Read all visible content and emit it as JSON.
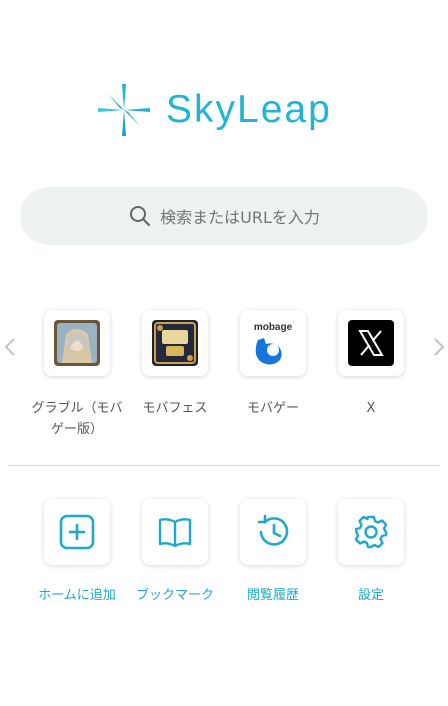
{
  "brand": {
    "name": "SkyLeap",
    "accent": "#22b4d6"
  },
  "search": {
    "placeholder": "検索またはURLを入力",
    "icon": "search-icon"
  },
  "shortcuts": [
    {
      "label": "グラブル（モバゲー版）",
      "icon": "granblue-app-icon"
    },
    {
      "label": "モバフェス",
      "icon": "mobafes-app-icon"
    },
    {
      "label": "モバゲー",
      "icon": "mobage-app-icon",
      "logo_text": "mobage"
    },
    {
      "label": "X",
      "icon": "x-app-icon"
    }
  ],
  "nav": {
    "prev": "chevron-left-icon",
    "next": "chevron-right-icon"
  },
  "actions": [
    {
      "label": "ホームに追加",
      "icon": "add-square-icon"
    },
    {
      "label": "ブックマーク",
      "icon": "book-open-icon"
    },
    {
      "label": "閲覧履歴",
      "icon": "history-icon"
    },
    {
      "label": "設定",
      "icon": "gear-icon"
    }
  ]
}
